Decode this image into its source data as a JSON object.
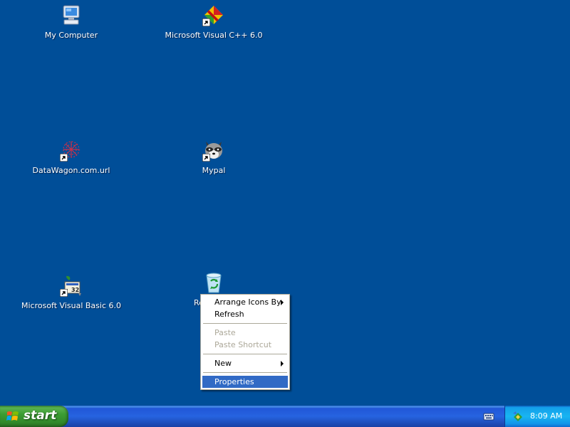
{
  "desktop": {
    "background": "#004e98",
    "icons": [
      {
        "label": "My Computer"
      },
      {
        "label": "Microsoft Visual C++ 6.0"
      },
      {
        "label": "DataWagon.com.url"
      },
      {
        "label": "Mypal"
      },
      {
        "label": "Microsoft Visual Basic 6.0"
      },
      {
        "label": "Re"
      }
    ]
  },
  "context_menu": {
    "items": [
      {
        "label": "Arrange Icons By",
        "submenu": true
      },
      {
        "label": "Refresh"
      },
      {
        "label": "Paste",
        "disabled": true
      },
      {
        "label": "Paste Shortcut",
        "disabled": true
      },
      {
        "label": "New",
        "submenu": true
      },
      {
        "label": "Properties",
        "highlighted": true
      }
    ],
    "highlight_color": "#316ac5"
  },
  "taskbar": {
    "start_label": "start",
    "clock": "8:09 AM"
  }
}
